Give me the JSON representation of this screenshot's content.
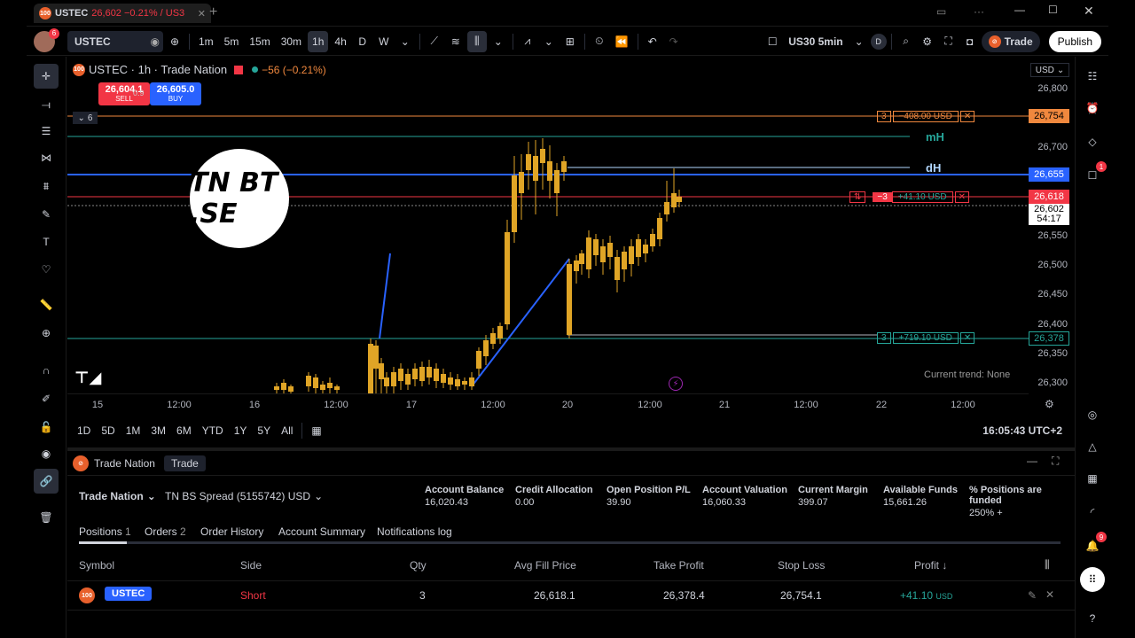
{
  "tab": {
    "title": "USTEC",
    "change": "26,602 −0.21% / US3"
  },
  "toolbar": {
    "avatar_badge": "6",
    "symbol": "USTEC",
    "intervals": [
      "1m",
      "5m",
      "15m",
      "30m",
      "1h",
      "4h",
      "D",
      "W"
    ],
    "active_interval": "1h",
    "compare_symbol": "US30 5min",
    "d_label": "D",
    "trade_label": "Trade",
    "publish_label": "Publish"
  },
  "legend": {
    "title": "USTEC · 1h · Trade Nation",
    "change": "−56 (−0.21%)",
    "sell_price": "26,604.1",
    "sell_label": "SELL",
    "spread": "0.9",
    "buy_price": "26,605.0",
    "buy_label": "BUY",
    "collapse_count": "6",
    "currency": "USD",
    "watermark": "TN BT .SE"
  },
  "chart_data": {
    "type": "candlestick",
    "y_ticks": [
      "26,800",
      "26,700",
      "26,650",
      "26,550",
      "26,500",
      "26,450",
      "26,400",
      "26,350",
      "26,300"
    ],
    "x_ticks": [
      "15",
      "12:00",
      "16",
      "12:00",
      "17",
      "12:00",
      "20",
      "12:00",
      "21",
      "12:00",
      "22",
      "12:00"
    ],
    "levels": [
      {
        "name": "stop-loss",
        "price": "26,754",
        "qty": "3",
        "pl": "−408.00 USD",
        "color": "#f0883e"
      },
      {
        "name": "mH",
        "label": "mH",
        "color": "#26a69a"
      },
      {
        "name": "dH",
        "label": "dH",
        "color": "#b2d7ff"
      },
      {
        "name": "blue-line",
        "price": "26,655",
        "color": "#2962ff"
      },
      {
        "name": "position",
        "price": "26,618",
        "qty": "−3",
        "pl": "+41.10 USD",
        "color": "#f23645"
      },
      {
        "name": "current",
        "price": "26,602",
        "countdown": "54:17"
      },
      {
        "name": "take-profit",
        "price": "26,378",
        "qty": "3",
        "pl": "+719.10 USD",
        "color": "#26a69a"
      }
    ],
    "trend_label": "Current trend: None"
  },
  "ranges": [
    "1D",
    "5D",
    "1M",
    "3M",
    "6M",
    "YTD",
    "1Y",
    "5Y",
    "All"
  ],
  "clock": "16:05:43 UTC+2",
  "panel": {
    "broker": "Trade Nation",
    "trade_btn": "Trade",
    "account_selector": "Trade Nation",
    "account_name": "TN BS Spread (5155742) USD",
    "stats": [
      {
        "label": "Account Balance",
        "value": "16,020.43"
      },
      {
        "label": "Credit Allocation",
        "value": "0.00"
      },
      {
        "label": "Open Position P/L",
        "value": "39.90"
      },
      {
        "label": "Account Valuation",
        "value": "16,060.33"
      },
      {
        "label": "Current Margin",
        "value": "399.07"
      },
      {
        "label": "Available Funds",
        "value": "15,661.26"
      },
      {
        "label": "% Positions are funded",
        "value": "250% +"
      }
    ],
    "tabs": [
      {
        "label": "Positions",
        "count": "1"
      },
      {
        "label": "Orders",
        "count": "2"
      },
      {
        "label": "Order History",
        "count": ""
      },
      {
        "label": "Account Summary",
        "count": ""
      },
      {
        "label": "Notifications log",
        "count": ""
      }
    ],
    "columns": [
      "Symbol",
      "Side",
      "Qty",
      "Avg Fill Price",
      "Take Profit",
      "Stop Loss",
      "Profit ↓"
    ],
    "row": {
      "symbol": "USTEC",
      "side": "Short",
      "qty": "3",
      "avg": "26,618.1",
      "tp": "26,378.4",
      "sl": "26,754.1",
      "profit": "+41.10",
      "profit_ccy": "USD"
    }
  },
  "right_badges": {
    "chat": "1",
    "notif": "9"
  },
  "colors": {
    "accent": "#2962ff",
    "sell": "#f23645",
    "buy": "#2962ff",
    "up": "#e0a526",
    "down": "#2962ff",
    "tp": "#26a69a",
    "sl": "#f0883e"
  }
}
